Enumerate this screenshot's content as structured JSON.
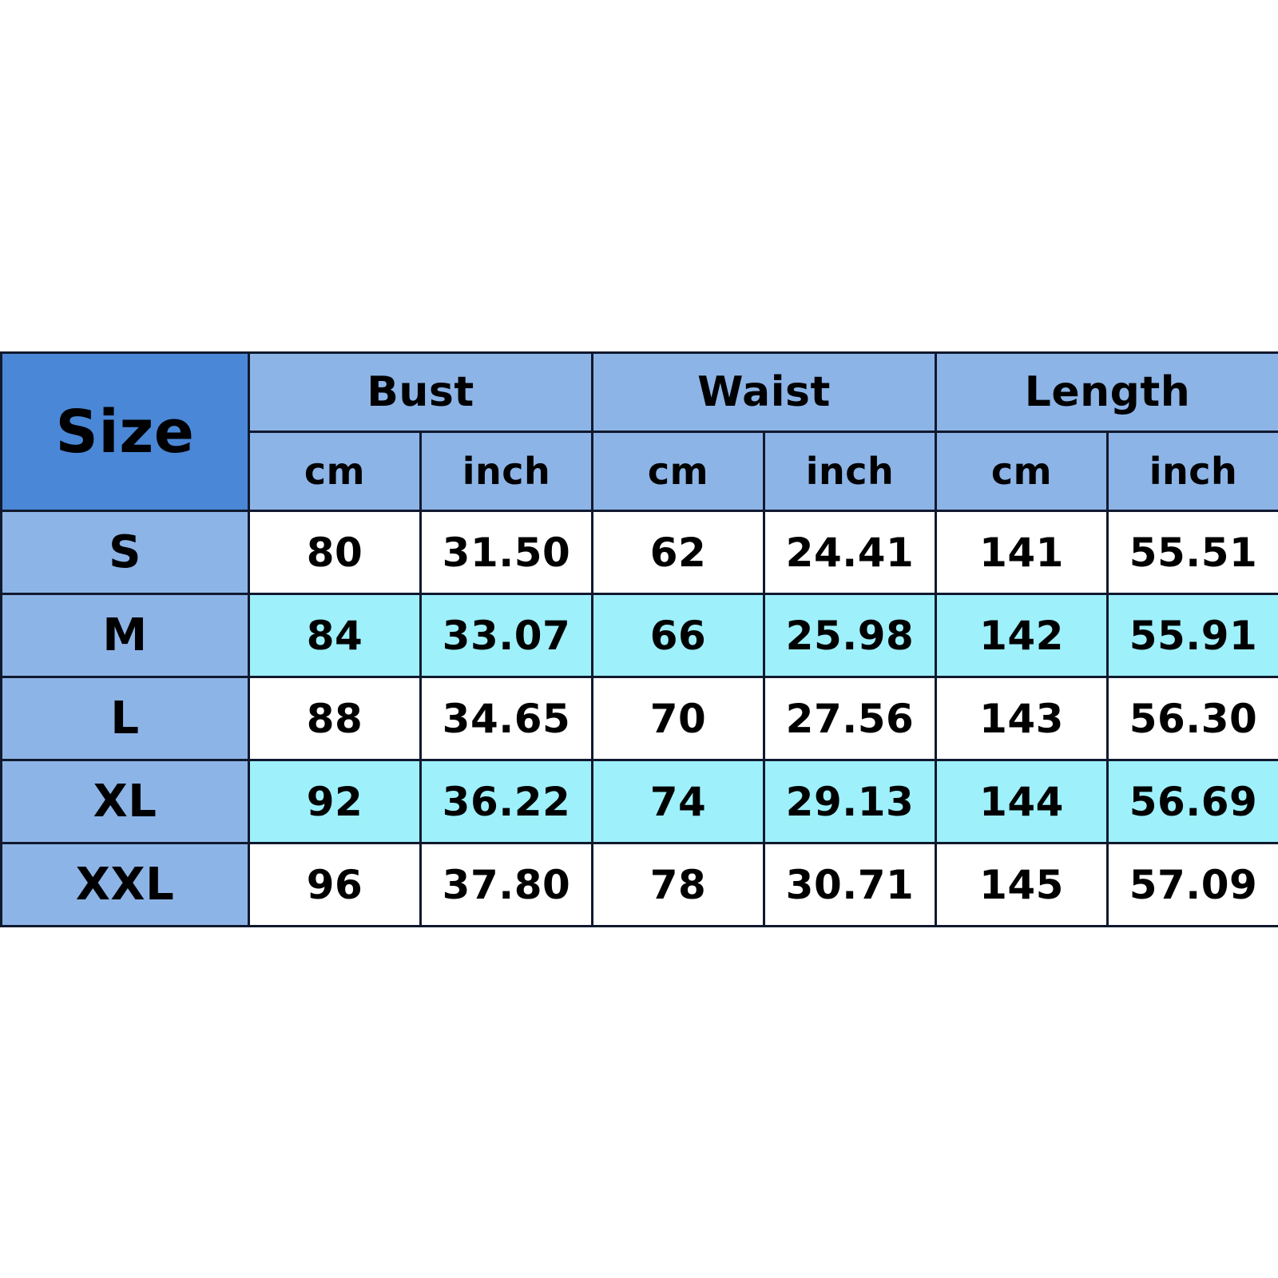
{
  "chart_data": {
    "type": "table",
    "title": "Size",
    "size_header_label": "Size",
    "group_headers": [
      "Bust",
      "Waist",
      "Length"
    ],
    "unit_headers": [
      "cm",
      "inch",
      "cm",
      "inch",
      "cm",
      "inch"
    ],
    "columns": [
      "Size",
      "Bust cm",
      "Bust inch",
      "Waist cm",
      "Waist inch",
      "Length cm",
      "Length inch"
    ],
    "rows": [
      {
        "size": "S",
        "bust_cm": "80",
        "bust_inch": "31.50",
        "waist_cm": "62",
        "waist_inch": "24.41",
        "length_cm": "141",
        "length_inch": "55.51",
        "highlighted": false
      },
      {
        "size": "M",
        "bust_cm": "84",
        "bust_inch": "33.07",
        "waist_cm": "66",
        "waist_inch": "25.98",
        "length_cm": "142",
        "length_inch": "55.91",
        "highlighted": true
      },
      {
        "size": "L",
        "bust_cm": "88",
        "bust_inch": "34.65",
        "waist_cm": "70",
        "waist_inch": "27.56",
        "length_cm": "143",
        "length_inch": "56.30",
        "highlighted": false
      },
      {
        "size": "XL",
        "bust_cm": "92",
        "bust_inch": "36.22",
        "waist_cm": "74",
        "waist_inch": "29.13",
        "length_cm": "144",
        "length_inch": "56.69",
        "highlighted": true
      },
      {
        "size": "XXL",
        "bust_cm": "96",
        "bust_inch": "37.80",
        "waist_cm": "78",
        "waist_inch": "30.71",
        "length_cm": "145",
        "length_inch": "57.09",
        "highlighted": false
      }
    ],
    "colors": {
      "size_header_bg": "#4a87d6",
      "group_header_bg": "#8db4e6",
      "unit_header_bg": "#8db4e6",
      "size_label_bg": "#8db4e6",
      "row_bg": "#ffffff",
      "row_highlight_bg": "#9ef0fb",
      "border": "#10192e",
      "text": "#000000",
      "page_bg": "#ffffff"
    }
  },
  "table": {
    "size_header": "Size",
    "groups": [
      {
        "label": "Bust",
        "units": [
          "cm",
          "inch"
        ]
      },
      {
        "label": "Waist",
        "units": [
          "cm",
          "inch"
        ]
      },
      {
        "label": "Length",
        "units": [
          "cm",
          "inch"
        ]
      }
    ],
    "units_flat": [
      "cm",
      "inch",
      "cm",
      "inch",
      "cm",
      "inch"
    ],
    "body": [
      {
        "size": "S",
        "values": [
          "80",
          "31.50",
          "62",
          "24.41",
          "141",
          "55.51"
        ]
      },
      {
        "size": "M",
        "values": [
          "84",
          "33.07",
          "66",
          "25.98",
          "142",
          "55.91"
        ]
      },
      {
        "size": "L",
        "values": [
          "88",
          "34.65",
          "70",
          "27.56",
          "143",
          "56.30"
        ]
      },
      {
        "size": "XL",
        "values": [
          "92",
          "36.22",
          "74",
          "29.13",
          "144",
          "56.69"
        ]
      },
      {
        "size": "XXL",
        "values": [
          "96",
          "37.80",
          "78",
          "30.71",
          "145",
          "57.09"
        ]
      }
    ]
  }
}
